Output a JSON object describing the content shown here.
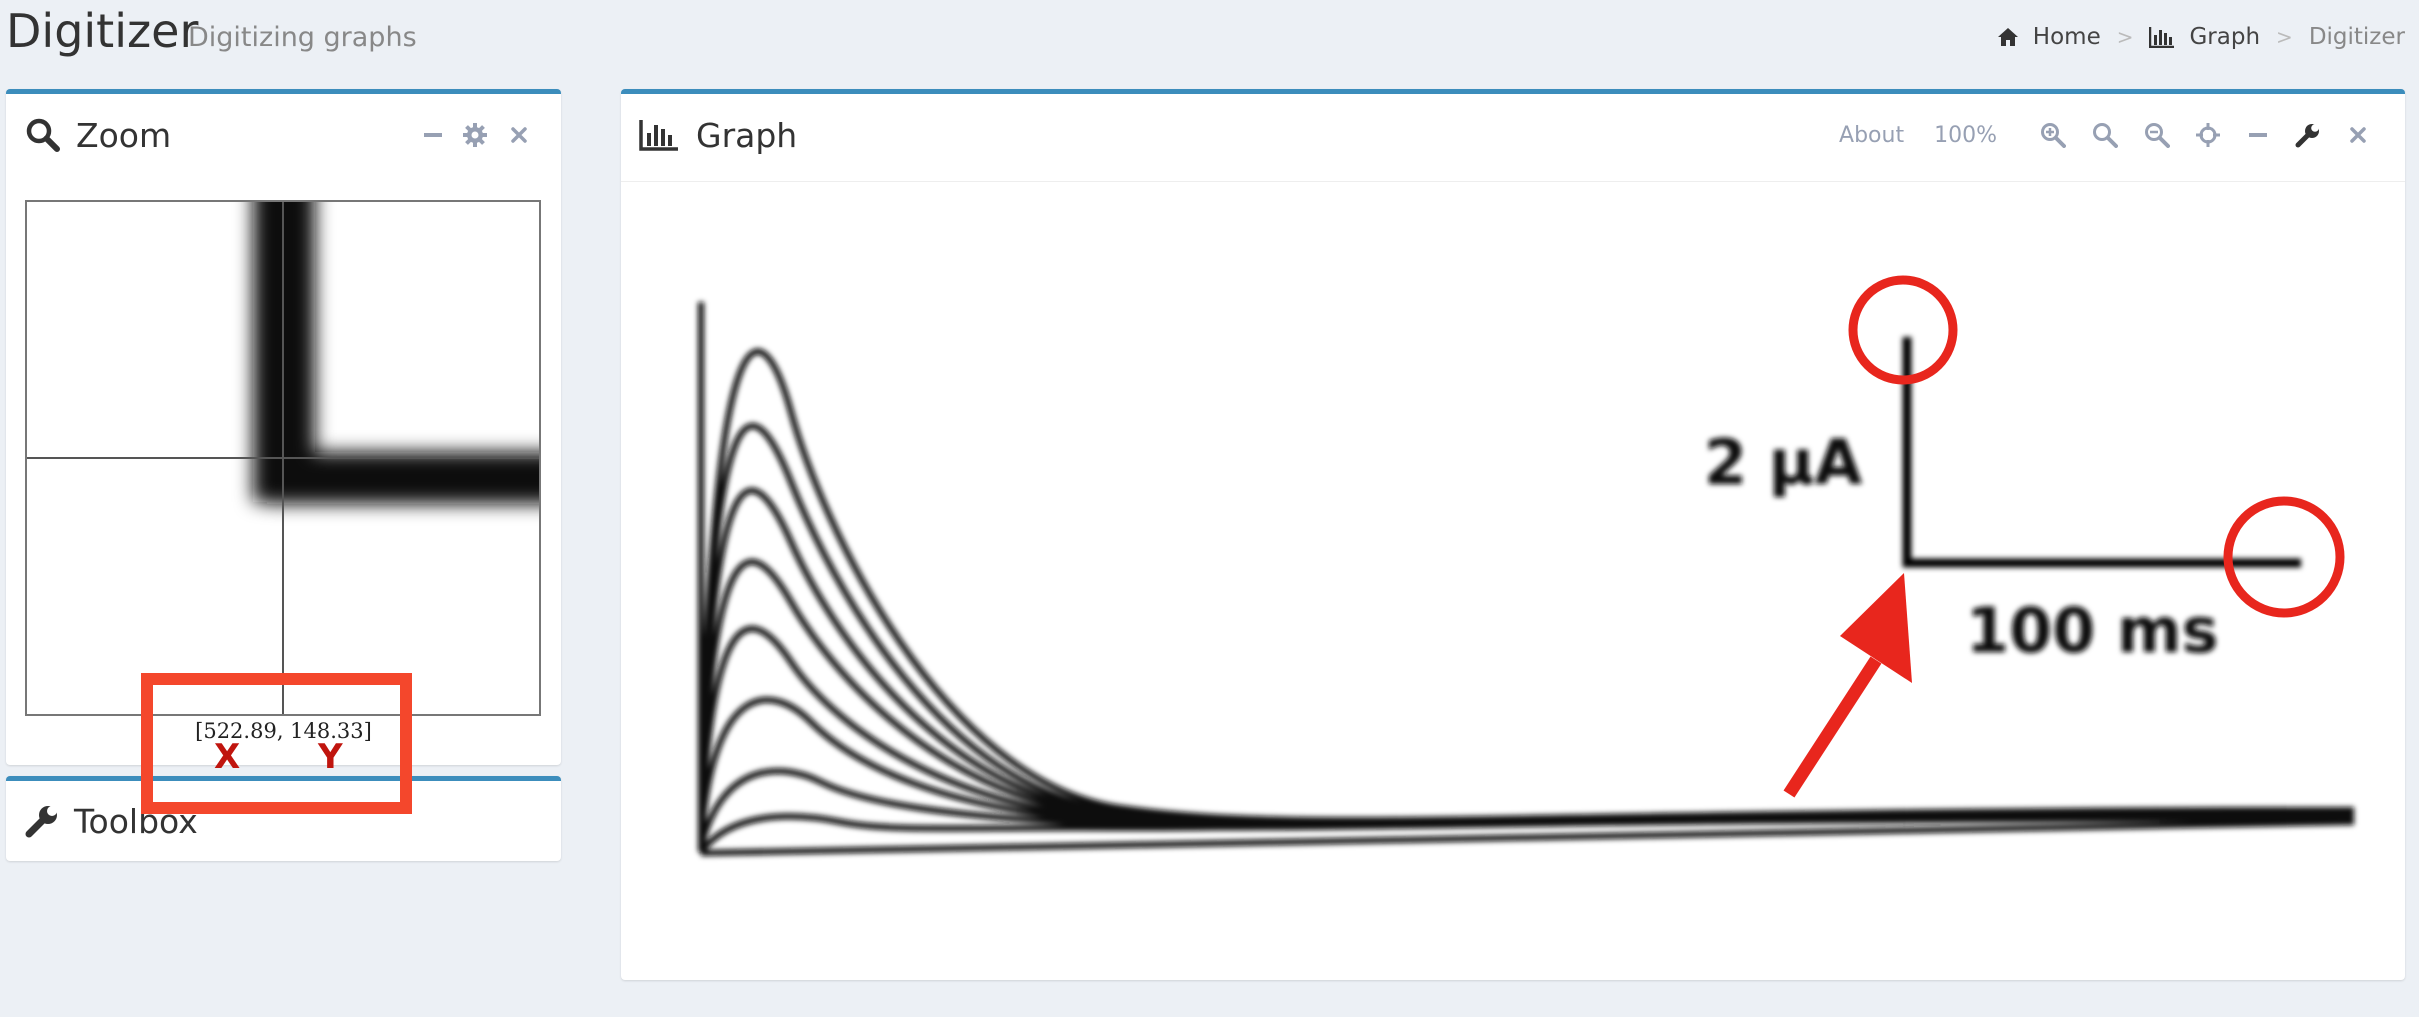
{
  "header": {
    "title": "Digitizer",
    "subtitle": "Digitizing graphs"
  },
  "breadcrumb": {
    "home": "Home",
    "graph": "Graph",
    "current": "Digitizer",
    "home_icon": "home-icon",
    "graph_icon": "bar-chart-icon"
  },
  "zoom_panel": {
    "title": "Zoom",
    "icon": "search-icon",
    "tools": [
      "minus-icon",
      "gear-icon",
      "close-icon"
    ],
    "coordinates": "[522.89, 148.33]"
  },
  "toolbox_panel": {
    "title": "Toolbox",
    "icon": "wrench-icon"
  },
  "graph_panel": {
    "title": "Graph",
    "icon": "bar-chart-icon",
    "about_label": "About",
    "zoom_level": "100%",
    "tools": [
      "zoom-in-icon",
      "search-icon",
      "zoom-out-icon",
      "crosshair-icon",
      "minus-icon",
      "wrench-icon",
      "close-icon"
    ]
  },
  "graph_image": {
    "scale_y_label": "2 µA",
    "scale_x_label": "100 ms"
  },
  "annotation": {
    "x_label": "X",
    "y_label": "Y"
  },
  "colors": {
    "panel_accent": "#3c8dbc",
    "annotation_red": "#e8261d",
    "background": "#ecf0f5"
  }
}
